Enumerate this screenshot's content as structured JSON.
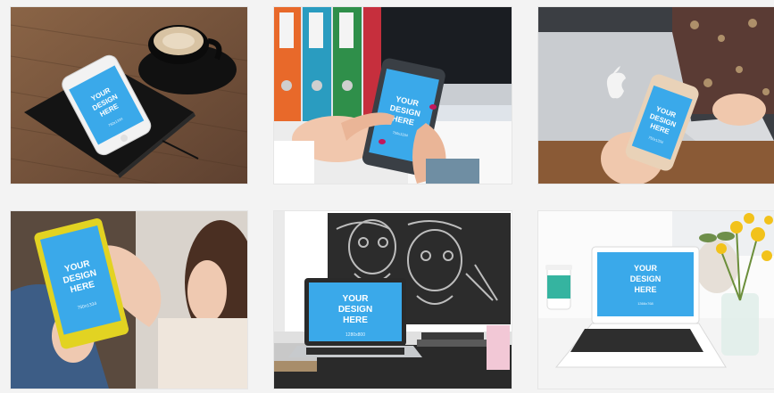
{
  "gallery": {
    "items": [
      {
        "screen_text": [
          "YOUR",
          "DESIGN",
          "HERE"
        ],
        "small_text": "750x1334"
      },
      {
        "screen_text": [
          "YOUR",
          "DESIGN",
          "HERE"
        ],
        "small_text": "750x1334"
      },
      {
        "screen_text": [
          "YOUR",
          "DESIGN",
          "HERE"
        ],
        "small_text": "750x1334"
      },
      {
        "screen_text": [
          "YOUR",
          "DESIGN",
          "HERE"
        ],
        "small_text": "750x1334"
      },
      {
        "screen_text": [
          "YOUR",
          "DESIGN",
          "HERE"
        ],
        "small_text": "1280x800"
      },
      {
        "screen_text": [
          "YOUR",
          "DESIGN",
          "HERE"
        ],
        "small_text": "1366x768"
      }
    ]
  },
  "colors": {
    "page_bg": "#f3f3f3",
    "screen_blue": "#3aa9ea",
    "card_bg": "#ffffff"
  }
}
